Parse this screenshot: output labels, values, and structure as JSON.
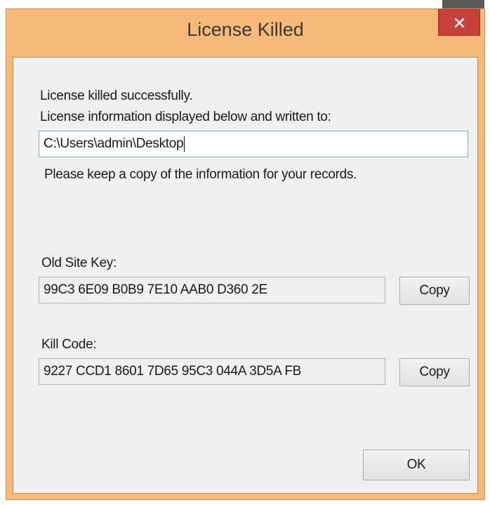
{
  "window": {
    "title": "License Killed",
    "close_glyph": "×"
  },
  "messages": {
    "success": "License killed successfully.",
    "written_to": "License information displayed below and written to:",
    "keep_copy": "Please keep a copy of the information for your records."
  },
  "path_field": {
    "value": "C:\\Users\\admin\\Desktop"
  },
  "site_key": {
    "label": "Old Site Key:",
    "value": "99C3 6E09 B0B9 7E10 AAB0 D360 2E",
    "copy_label": "Copy"
  },
  "kill_code": {
    "label": "Kill Code:",
    "value": "9227 CCD1 8601 7D65 95C3 044A 3D5A FB",
    "copy_label": "Copy"
  },
  "ok_label": "OK",
  "colors": {
    "frame": "#f6b978",
    "close": "#c8413b",
    "client": "#f0f0f0",
    "focus_border": "#7aa7d8"
  },
  "icons": {
    "close": "close-icon"
  }
}
